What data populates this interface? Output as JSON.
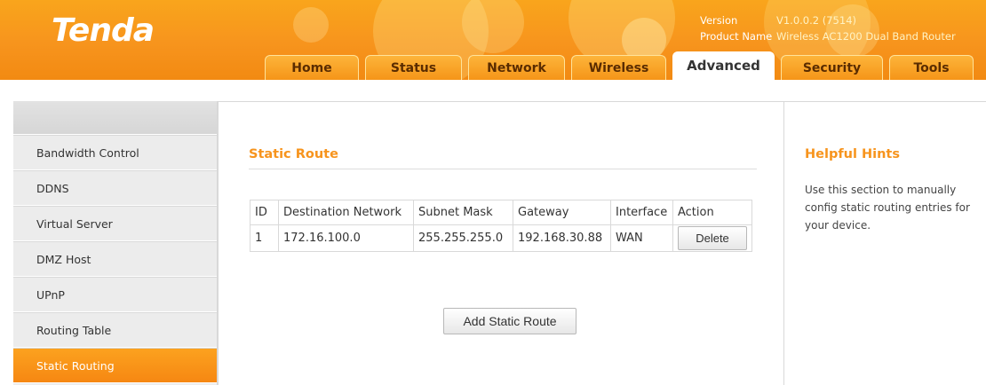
{
  "header": {
    "logo": "Tenda",
    "version_label": "Version",
    "version_value": "V1.0.0.2 (7514)",
    "product_label": "Product Name",
    "product_value": "Wireless AC1200 Dual Band Router"
  },
  "tabs": [
    {
      "label": "Home",
      "active": false
    },
    {
      "label": "Status",
      "active": false
    },
    {
      "label": "Network",
      "active": false
    },
    {
      "label": "Wireless",
      "active": false
    },
    {
      "label": "Advanced",
      "active": true
    },
    {
      "label": "Security",
      "active": false
    },
    {
      "label": "Tools",
      "active": false
    }
  ],
  "sidebar": {
    "items": [
      {
        "label": "Bandwidth Control",
        "active": false
      },
      {
        "label": "DDNS",
        "active": false
      },
      {
        "label": "Virtual Server",
        "active": false
      },
      {
        "label": "DMZ Host",
        "active": false
      },
      {
        "label": "UPnP",
        "active": false
      },
      {
        "label": "Routing Table",
        "active": false
      },
      {
        "label": "Static Routing",
        "active": true
      }
    ]
  },
  "main": {
    "title": "Static Route",
    "table": {
      "headers": [
        "ID",
        "Destination Network",
        "Subnet Mask",
        "Gateway",
        "Interface",
        "Action"
      ],
      "rows": [
        {
          "id": "1",
          "destination": "172.16.100.0",
          "mask": "255.255.255.0",
          "gateway": "192.168.30.88",
          "interface": "WAN",
          "action": "Delete"
        }
      ]
    },
    "add_button": "Add Static Route"
  },
  "hints": {
    "title": "Helpful Hints",
    "text": "Use this section to manually config static routing entries for your device."
  },
  "colors": {
    "accent": "#f7941d",
    "header_bg": "#f9a51c",
    "sidebar_bg": "#ececec"
  }
}
